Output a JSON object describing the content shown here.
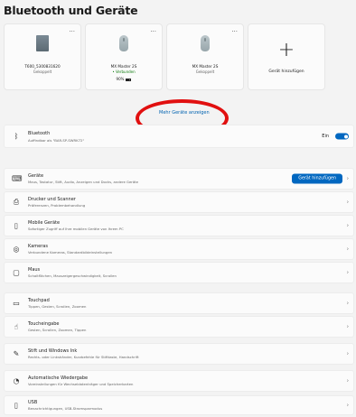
{
  "page": {
    "title": "Bluetooth und Geräte"
  },
  "devices": [
    {
      "name": "T600_5300831620",
      "status": "Gekoppelt",
      "icon": "laptop-icon",
      "connected": false,
      "battery": ""
    },
    {
      "name": "MX Master 2S",
      "status": "Verbunden",
      "icon": "mouse-icon",
      "connected": true,
      "battery": "90%"
    },
    {
      "name": "MX Master 2S",
      "status": "Gekoppelt",
      "icon": "mouse-icon",
      "connected": false,
      "battery": ""
    }
  ],
  "more_menu_glyph": "...",
  "add_device_card": {
    "label": "Gerät hinzufügen",
    "glyph": "+"
  },
  "more_devices_link": "Mehr Geräte anzeigen",
  "bluetooth": {
    "title": "Bluetooth",
    "subtitle": "Auffindbar als \"BAR-SP-SWRK72\"",
    "state": "Ein"
  },
  "settings": [
    {
      "title": "Geräte",
      "subtitle": "Maus, Tastatur, Stift, Audio, Anzeigen und Docks, andere Geräte",
      "icon": "keyboard-icon",
      "button": "Gerät hinzufügen"
    },
    {
      "title": "Drucker und Scanner",
      "subtitle": "Präferenzen, Problembehandlung",
      "icon": "printer-icon"
    },
    {
      "title": "Mobile Geräte",
      "subtitle": "Sofortiger Zugriff auf Ihre mobilen Geräte von Ihrem PC",
      "icon": "phone-icon"
    },
    {
      "title": "Kameras",
      "subtitle": "Verbundene Kameras, Standardbildeinstellungen",
      "icon": "camera-icon"
    },
    {
      "title": "Maus",
      "subtitle": "Schaltflächen, Mauszeigergeschwindigkeit, Scrollen",
      "icon": "mouse-icon"
    },
    {
      "title": "Touchpad",
      "subtitle": "Tippen, Gesten, Scrollen, Zoomen",
      "icon": "touchpad-icon"
    },
    {
      "title": "Toucheingabe",
      "subtitle": "Gesten, Scrollen, Zoomen, Tippen",
      "icon": "touch-icon"
    },
    {
      "title": "Stift und Windows Ink",
      "subtitle": "Rechts- oder Linkshänder, Kurzbefehle für Stifttaste, Handschrift",
      "icon": "pen-icon"
    },
    {
      "title": "Automatische Wiedergabe",
      "subtitle": "Voreinstellungen für Wechseldatenträger und Speicherkarten",
      "icon": "autoplay-icon"
    },
    {
      "title": "USB",
      "subtitle": "Benachrichtigungen, USB-Stromsparmodus",
      "icon": "usb-icon"
    }
  ],
  "chevron": "›",
  "colors": {
    "accent": "#0067c0",
    "connected": "#107c10",
    "annotation": "#e11010"
  }
}
